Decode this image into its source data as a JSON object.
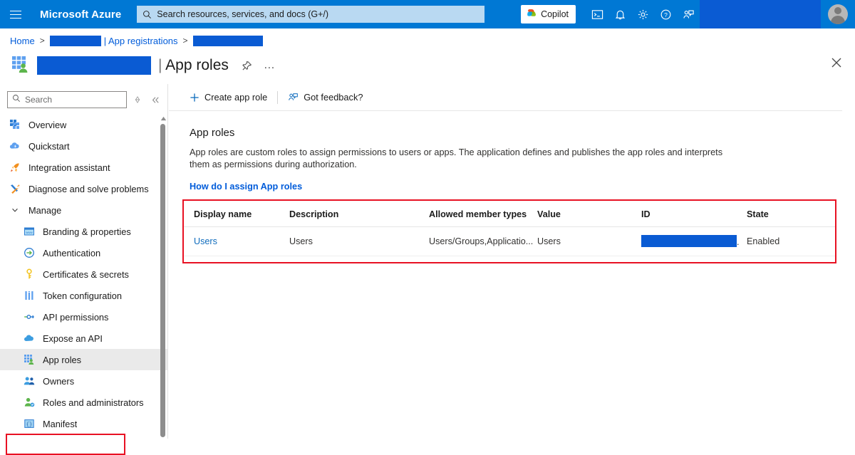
{
  "topbar": {
    "menu_icon": "hamburger-icon",
    "brand": "Microsoft Azure",
    "search_placeholder": "Search resources, services, and docs (G+/)",
    "search_icon": "search-icon",
    "copilot_label": "Copilot",
    "copilot_icon": "copilot-icon",
    "icons": [
      {
        "name": "cloud-shell-icon"
      },
      {
        "name": "notifications-bell-icon"
      },
      {
        "name": "settings-gear-icon"
      },
      {
        "name": "help-question-icon"
      },
      {
        "name": "feedback-person-icon"
      }
    ],
    "redacted_region": "redacted-account-name",
    "avatar": "user-avatar"
  },
  "breadcrumb": {
    "home": "Home",
    "separator": ">",
    "tenant_redacted": "redacted-tenant-name",
    "app_registrations": "| App registrations",
    "app_redacted": "redacted-app-name"
  },
  "page": {
    "icon": "app-roles-icon",
    "app_name_redacted": "redacted-app-name",
    "pipe": "|",
    "title": "App roles",
    "pin_icon": "pin-icon",
    "more_icon": "more-ellipsis-icon",
    "close_icon": "close-icon"
  },
  "sidebar": {
    "search_placeholder": "Search",
    "search_icon": "search-icon",
    "sort_icon": "sort-diamond-icon",
    "collapse_icon": "double-chevron-left-icon",
    "scroll_up_icon": "scroll-up-arrow-icon",
    "items": [
      {
        "label": "Overview",
        "icon": "overview-grid-icon",
        "level": "top",
        "selected": false
      },
      {
        "label": "Quickstart",
        "icon": "quickstart-cloud-icon",
        "level": "top",
        "selected": false
      },
      {
        "label": "Integration assistant",
        "icon": "rocket-icon",
        "level": "top",
        "selected": false
      },
      {
        "label": "Diagnose and solve problems",
        "icon": "wrench-screwdriver-icon",
        "level": "top",
        "selected": false
      },
      {
        "label": "Manage",
        "icon": "chevron-down-icon",
        "level": "group",
        "selected": false
      },
      {
        "label": "Branding & properties",
        "icon": "branding-window-icon",
        "level": "sub",
        "selected": false
      },
      {
        "label": "Authentication",
        "icon": "authentication-arrow-icon",
        "level": "sub",
        "selected": false
      },
      {
        "label": "Certificates & secrets",
        "icon": "key-icon",
        "level": "sub",
        "selected": false
      },
      {
        "label": "Token configuration",
        "icon": "token-bars-icon",
        "level": "sub",
        "selected": false
      },
      {
        "label": "API permissions",
        "icon": "api-permissions-icon",
        "level": "sub",
        "selected": false
      },
      {
        "label": "Expose an API",
        "icon": "cloud-icon",
        "level": "sub",
        "selected": false
      },
      {
        "label": "App roles",
        "icon": "app-roles-icon",
        "level": "sub",
        "selected": true
      },
      {
        "label": "Owners",
        "icon": "owners-people-icon",
        "level": "sub",
        "selected": false
      },
      {
        "label": "Roles and administrators",
        "icon": "roles-admin-icon",
        "level": "sub",
        "selected": false
      },
      {
        "label": "Manifest",
        "icon": "manifest-brackets-icon",
        "level": "sub",
        "selected": false
      }
    ]
  },
  "command_bar": {
    "create_label": "Create app role",
    "create_icon": "plus-icon",
    "feedback_label": "Got feedback?",
    "feedback_icon": "feedback-person-icon"
  },
  "main": {
    "heading": "App roles",
    "description": "App roles are custom roles to assign permissions to users or apps. The application defines and publishes the app roles and interprets them as permissions during authorization.",
    "help_link": "How do I assign App roles"
  },
  "table": {
    "columns": [
      "Display name",
      "Description",
      "Allowed member types",
      "Value",
      "ID",
      "State"
    ],
    "rows": [
      {
        "display_name": "Users",
        "description": "Users",
        "allowed_member_types": "Users/Groups,Applicatio...",
        "value": "Users",
        "id_redacted": "redacted-role-id",
        "id_suffix": ".",
        "state": "Enabled"
      }
    ]
  },
  "annotations": [
    {
      "name": "annotation-app-roles-nav",
      "color": "#e81123"
    },
    {
      "name": "annotation-app-roles-table",
      "color": "#e81123"
    }
  ],
  "colors": {
    "azure_blue": "#0078d4",
    "redaction_blue": "#0a5bd3",
    "link_blue": "#015cda",
    "annotation_red": "#e81123",
    "selected_row": "#eaeaea"
  }
}
